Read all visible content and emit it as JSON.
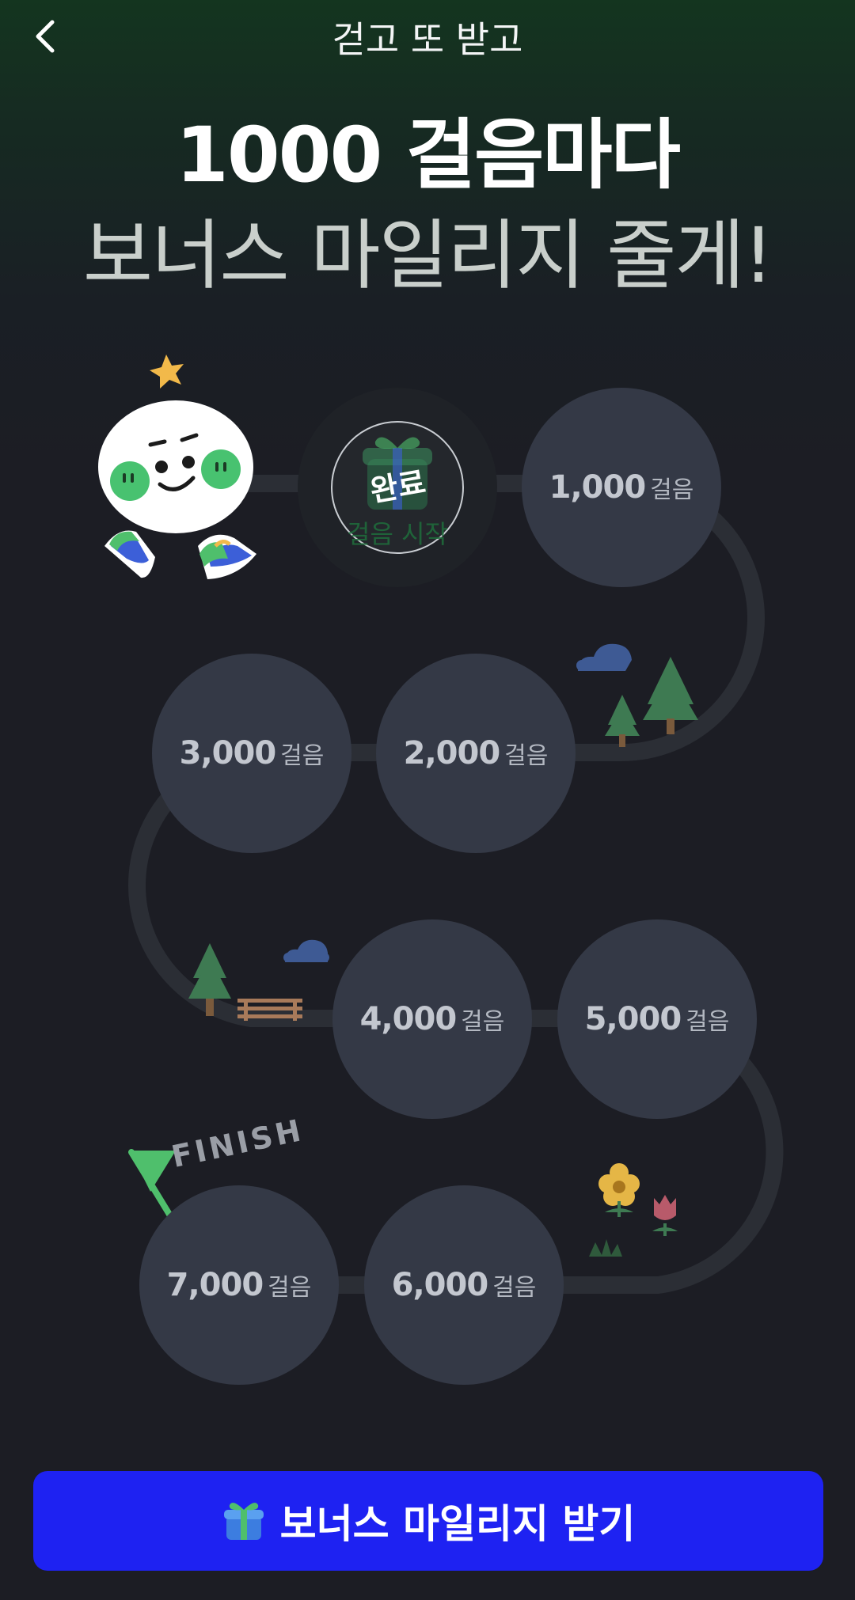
{
  "header": {
    "title": "걷고 또 받고",
    "back_icon": "chevron-left-icon"
  },
  "hero": {
    "line1": "1000 걸음마다",
    "line2": "보너스 마일리지 줄게!"
  },
  "track": {
    "start": {
      "badge": "완료",
      "label": "걸음 시작"
    },
    "unit": "걸음",
    "milestones": [
      {
        "value": "1,000"
      },
      {
        "value": "2,000"
      },
      {
        "value": "3,000"
      },
      {
        "value": "4,000"
      },
      {
        "value": "5,000"
      },
      {
        "value": "6,000"
      },
      {
        "value": "7,000"
      }
    ],
    "finish_label": "FINISH"
  },
  "cta": {
    "label": "보너스 마일리지 받기",
    "icon": "gift-icon"
  },
  "colors": {
    "accent": "#1E22F2",
    "circle": "#343946",
    "background": "#1C1D24",
    "track": "#2B2E35"
  }
}
